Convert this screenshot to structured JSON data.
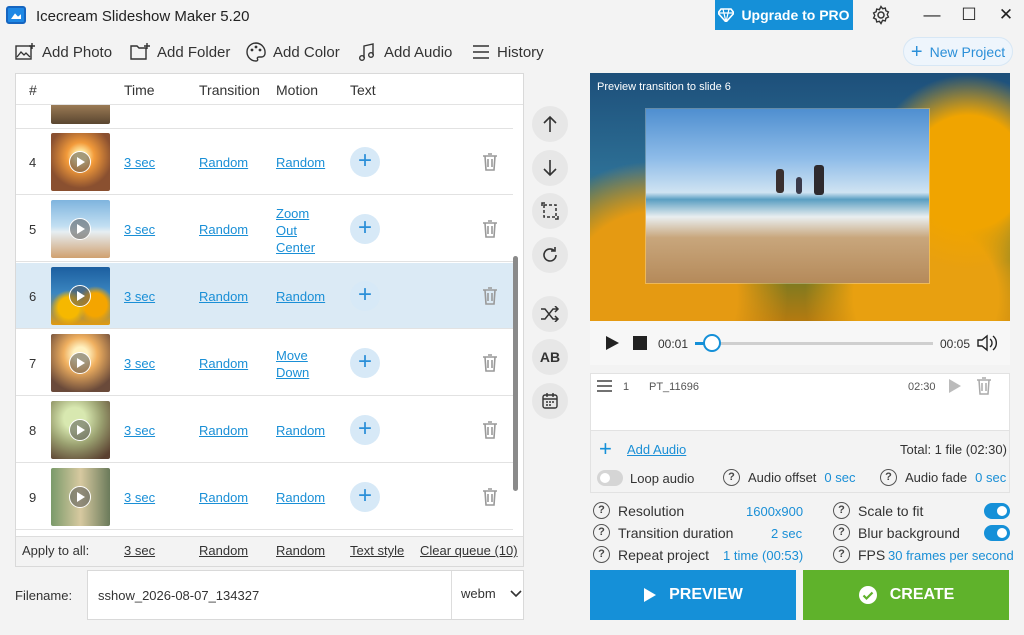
{
  "app": {
    "title": "Icecream Slideshow Maker 5.20",
    "upgrade_label": "Upgrade to PRO"
  },
  "toolbar": {
    "add_photo": "Add Photo",
    "add_folder": "Add Folder",
    "add_color": "Add Color",
    "add_audio": "Add Audio",
    "history": "History",
    "new_project": "New Project"
  },
  "table": {
    "headers": {
      "num": "#",
      "time": "Time",
      "transition": "Transition",
      "motion": "Motion",
      "text": "Text"
    },
    "rows": [
      {
        "num": "4",
        "time": "3 sec",
        "transition": "Random",
        "motion": "Random"
      },
      {
        "num": "5",
        "time": "3 sec",
        "transition": "Random",
        "motion": "Zoom Out Center"
      },
      {
        "num": "6",
        "time": "3 sec",
        "transition": "Random",
        "motion": "Random"
      },
      {
        "num": "7",
        "time": "3 sec",
        "transition": "Random",
        "motion": "Move Down"
      },
      {
        "num": "8",
        "time": "3 sec",
        "transition": "Random",
        "motion": "Random"
      },
      {
        "num": "9",
        "time": "3 sec",
        "transition": "Random",
        "motion": "Random"
      }
    ],
    "selected_row": "6"
  },
  "apply_all": {
    "label": "Apply to all:",
    "time": "3 sec",
    "transition": "Random",
    "motion": "Random",
    "text_style": "Text style",
    "clear_queue": "Clear queue (10)"
  },
  "filename": {
    "label": "Filename:",
    "value": "sshow_2026-08-07_134327",
    "format": "webm"
  },
  "preview": {
    "caption": "Preview transition to slide 6"
  },
  "player": {
    "current": "00:01",
    "total": "00:05",
    "progress": 0.07
  },
  "audio": {
    "track_index": "1",
    "track_name": "PT_11696",
    "track_duration": "02:30",
    "add_audio": "Add Audio",
    "total": "Total: 1 file (02:30)",
    "loop_label": "Loop audio",
    "offset_label": "Audio offset",
    "offset_value": "0 sec",
    "fade_label": "Audio fade",
    "fade_value": "0 sec"
  },
  "settings": {
    "resolution_label": "Resolution",
    "resolution_value": "1600x900",
    "transition_label": "Transition duration",
    "transition_value": "2 sec",
    "repeat_label": "Repeat project",
    "repeat_value": "1 time (00:53)",
    "scale_label": "Scale to fit",
    "blur_label": "Blur background",
    "fps_label": "FPS",
    "fps_value": "30 frames per second"
  },
  "actions": {
    "preview": "PREVIEW",
    "create": "CREATE"
  },
  "colors": {
    "accent": "#1590d8",
    "create": "#5fb22b",
    "selected_row": "#dbeaf5"
  }
}
